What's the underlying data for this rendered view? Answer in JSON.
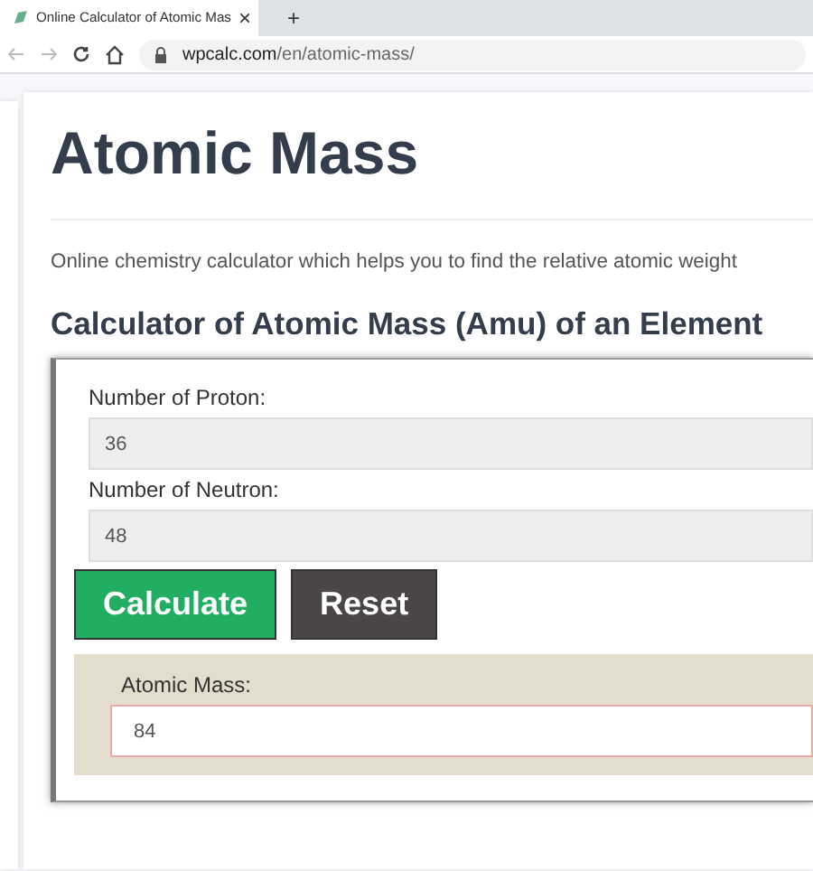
{
  "browser": {
    "tab_title": "Online Calculator of Atomic Mas",
    "close_glyph": "×",
    "new_tab_glyph": "+",
    "url_host": "wpcalc.com",
    "url_path": "/en/atomic-mass/"
  },
  "page": {
    "title": "Atomic Mass",
    "intro": "Online chemistry calculator which helps you to find the relative atomic weight",
    "subtitle": "Calculator of Atomic Mass (Amu) of an Element"
  },
  "calculator": {
    "fields": [
      {
        "label": "Number of Proton:",
        "value": "36"
      },
      {
        "label": "Number of Neutron:",
        "value": "48"
      }
    ],
    "buttons": [
      {
        "label": "Calculate",
        "kind": "primary"
      },
      {
        "label": "Reset",
        "kind": "secondary"
      }
    ],
    "result": {
      "label": "Atomic Mass:",
      "value": "84"
    }
  }
}
